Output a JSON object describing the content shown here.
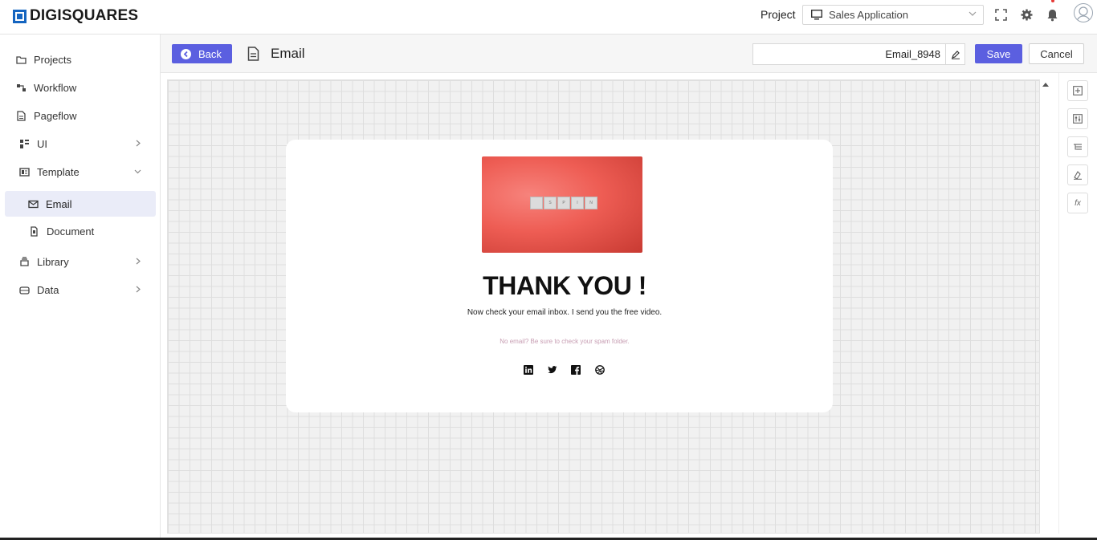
{
  "brand": {
    "name": "DIGISQUARES",
    "color": "#1565c0"
  },
  "topbar": {
    "project_label": "Project",
    "project_select": {
      "value": "Sales Application"
    }
  },
  "sidebar": {
    "items": [
      {
        "label": "Projects",
        "icon": "folder-icon"
      },
      {
        "label": "Workflow",
        "icon": "workflow-icon"
      },
      {
        "label": "Pageflow",
        "icon": "pageflow-icon"
      },
      {
        "label": "UI",
        "icon": "ui-icon",
        "expandable": true
      },
      {
        "label": "Template",
        "icon": "template-icon",
        "expanded": true
      },
      {
        "label": "Email",
        "icon": "mail-icon",
        "active": true
      },
      {
        "label": "Document",
        "icon": "document-icon"
      },
      {
        "label": "Library",
        "icon": "library-icon",
        "expandable": true
      },
      {
        "label": "Data",
        "icon": "data-icon",
        "expandable": true
      }
    ]
  },
  "header": {
    "back_label": "Back",
    "title": "Email",
    "name_value": "Email_8948",
    "save_label": "Save",
    "cancel_label": "Cancel"
  },
  "email": {
    "hero_tiles": [
      "",
      "S",
      "P",
      "I",
      "N"
    ],
    "heading": "THANK YOU !",
    "subtitle": "Now check your email inbox. I send you the free video.",
    "spam_note": "No email? Be sure to check your spam folder.",
    "socials": [
      "linkedin-icon",
      "twitter-icon",
      "facebook-icon",
      "dribbble-icon"
    ]
  },
  "rail": {
    "buttons": [
      "add-block-icon",
      "adjust-icon",
      "layers-icon",
      "style-icon",
      "fx-icon"
    ],
    "fx_label": "fx"
  },
  "colors": {
    "accent": "#5b5fe0",
    "hero": "#ee5d54",
    "active_bg": "#eaecf8"
  }
}
